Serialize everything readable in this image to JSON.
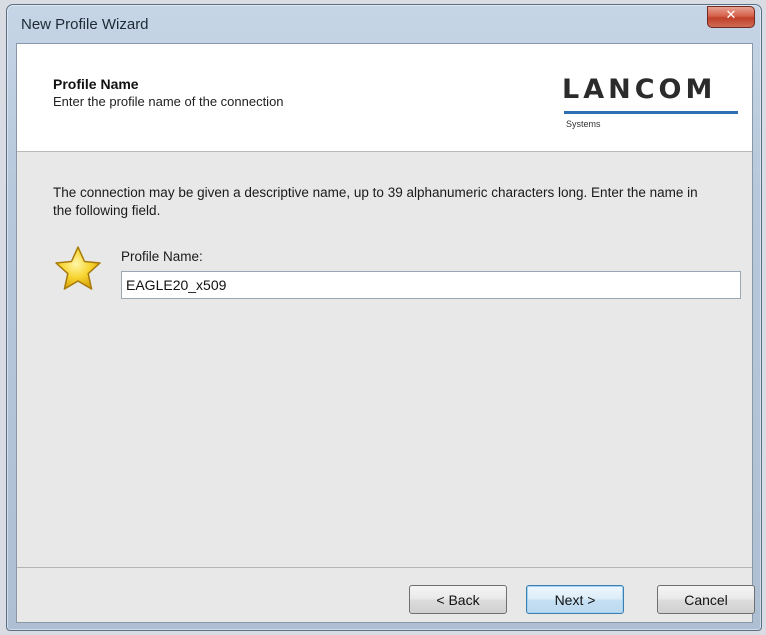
{
  "window": {
    "title": "New Profile Wizard",
    "close_glyph": "✕"
  },
  "header": {
    "title": "Profile Name",
    "subtitle": "Enter the profile name of the connection",
    "logo": {
      "name": "LANCOM",
      "sub": "Systems",
      "accent": "#2e6fb3"
    }
  },
  "body": {
    "description": "The connection may be given a descriptive name, up to 39 alphanumeric characters long. Enter the name in the following field.",
    "icon": "star-icon",
    "field": {
      "label": "Profile Name:",
      "value": "EAGLE20_x509"
    }
  },
  "buttons": {
    "back": "< Back",
    "next": "Next >",
    "cancel": "Cancel"
  }
}
